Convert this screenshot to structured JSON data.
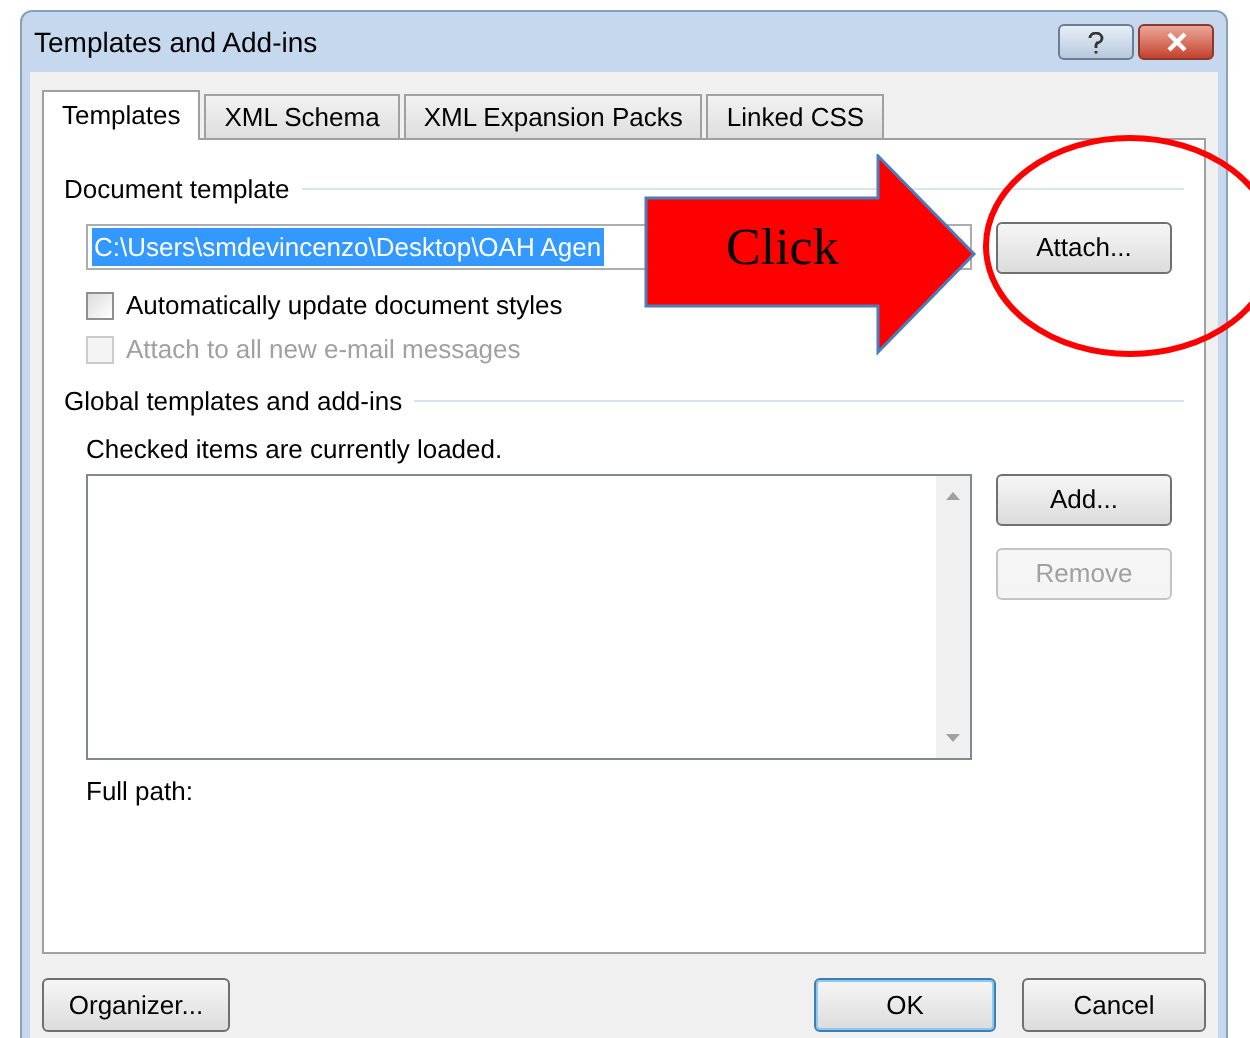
{
  "window": {
    "title": "Templates and Add-ins"
  },
  "tabs": [
    {
      "label": "Templates",
      "selected": true
    },
    {
      "label": "XML Schema",
      "selected": false
    },
    {
      "label": "XML Expansion Packs",
      "selected": false
    },
    {
      "label": "Linked CSS",
      "selected": false
    }
  ],
  "document_template": {
    "heading": "Document template",
    "value": "C:\\Users\\smdevincenzo\\Desktop\\OAH Agen",
    "attach_button": "Attach...",
    "options": [
      {
        "label": "Automatically update document styles",
        "checked": false,
        "disabled": false
      },
      {
        "label": "Attach to all new e-mail messages",
        "checked": false,
        "disabled": true
      }
    ]
  },
  "global_templates": {
    "heading": "Global templates and add-ins",
    "hint": "Checked items are currently loaded.",
    "buttons": [
      {
        "label": "Add...",
        "disabled": false
      },
      {
        "label": "Remove",
        "disabled": true
      }
    ],
    "full_path_label": "Full path:"
  },
  "footer_buttons": [
    {
      "label": "Organizer...",
      "default": false
    },
    {
      "label": "OK",
      "default": true
    },
    {
      "label": "Cancel",
      "default": false
    }
  ],
  "annotation": {
    "text": "Click"
  }
}
